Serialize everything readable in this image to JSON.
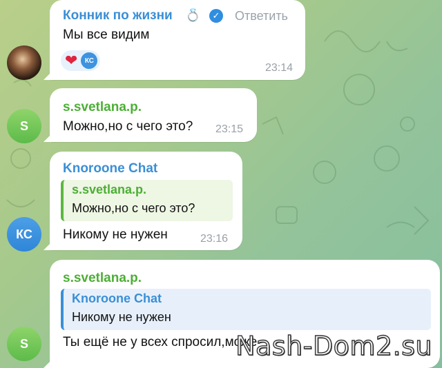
{
  "messages": [
    {
      "sender": "Конник по жизни",
      "sender_emoji": "💍",
      "reply_action": "Ответить",
      "text": "Мы все видим",
      "reactions": {
        "emoji": "❤",
        "avatar_initials": "КС"
      },
      "time": "23:14"
    },
    {
      "sender": "s.svetlana.p.",
      "avatar_initial": "S",
      "text": "Можно,но с чего это?",
      "time": "23:15"
    },
    {
      "sender": "Knoroone Chat",
      "avatar_initials": "КС",
      "quote": {
        "name": "s.svetlana.p.",
        "text": "Можно,но с чего это?"
      },
      "text": "Никому не нужен",
      "time": "23:16"
    },
    {
      "sender": "s.svetlana.p.",
      "avatar_initial": "S",
      "quote": {
        "name": "Knoroone Chat",
        "text": "Никому не нужен"
      },
      "text": "Ты ещё не у всех спросил,може"
    }
  ],
  "watermark": "Nash-Dom2.su",
  "colors": {
    "sender_blue": "#3a8fd6",
    "sender_green": "#4caf35",
    "verified_badge": "#2f8ee0",
    "heart": "#e0243c"
  }
}
